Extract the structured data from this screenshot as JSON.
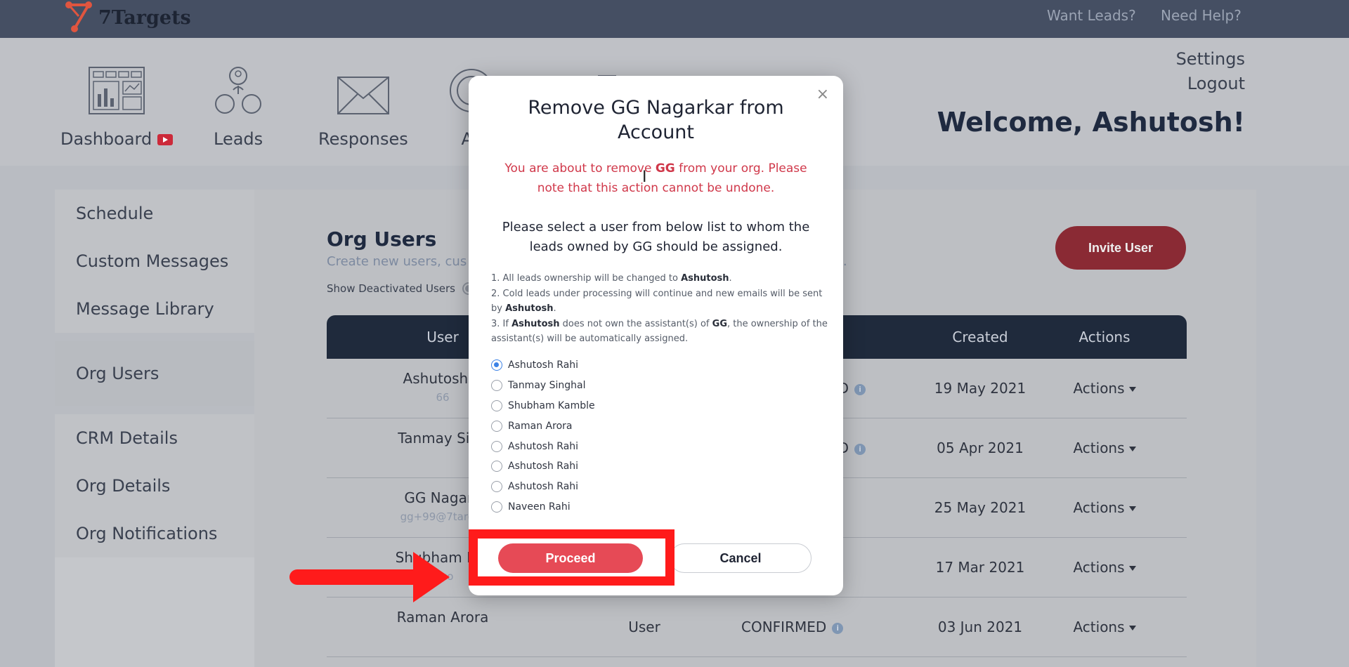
{
  "topbar": {
    "logo_text": "7Targets",
    "want_leads": "Want Leads?",
    "need_help": "Need Help?"
  },
  "nav": {
    "dashboard": "Dashboard",
    "leads": "Leads",
    "responses": "Responses",
    "assistants": "As"
  },
  "header": {
    "settings": "Settings",
    "logout": "Logout",
    "welcome": "Welcome, Ashutosh!"
  },
  "sidebar": {
    "items": [
      "Schedule",
      "Custom Messages",
      "Message Library",
      "Org Users",
      "CRM Details",
      "Org Details",
      "Org Notifications"
    ],
    "active": "Org Users"
  },
  "main": {
    "title": "Org Users",
    "subtitle": "Create new users, cus",
    "subtitle_end": "unt.",
    "show_deactivated": "Show Deactivated Users",
    "invite_button": "Invite User",
    "columns": {
      "user": "User",
      "created": "Created",
      "actions": "Actions"
    },
    "rows": [
      {
        "name": "Ashutosh R",
        "email": "66",
        "role": "",
        "status": "ORD",
        "created": "19 May 2021",
        "actions": "Actions"
      },
      {
        "name": "Tanmay Sing",
        "email": "",
        "role": "",
        "status": "ORD",
        "created": "05 Apr 2021",
        "actions": "Actions"
      },
      {
        "name": "GG Nagark",
        "email": "gg+99@7target",
        "role": "",
        "status": "",
        "created": "25 May 2021",
        "actions": "Actions"
      },
      {
        "name": "Shubham Kar",
        "email": "aico",
        "role": "",
        "status": "",
        "created": "17 Mar 2021",
        "actions": "Actions"
      },
      {
        "name": "Raman Arora",
        "email": "",
        "role": "User",
        "status": "CONFIRMED",
        "created": "03 Jun 2021",
        "actions": "Actions"
      }
    ]
  },
  "modal": {
    "title": "Remove GG Nagarkar from Account",
    "warning_pre": "You are about to remove ",
    "warning_bold": "GG",
    "warning_post": " from your org. Please note that this action cannot be undone.",
    "prompt": "Please select a user from below list to whom the leads owned by GG should be assigned.",
    "note1_pre": "1. All leads ownership will be changed to ",
    "note1_bold": "Ashutosh",
    "note1_post": ".",
    "note2_pre": "2. Cold leads under processing will continue and new emails will be sent by ",
    "note2_bold": "Ashutosh",
    "note2_post": ".",
    "note3_pre": "3. If ",
    "note3_bold": "Ashutosh",
    "note3_mid": " does not own the assistant(s) of ",
    "note3_bold2": "GG",
    "note3_post": ", the ownership of the assistant(s) will be automatically assigned.",
    "users": [
      "Ashutosh Rahi",
      "Tanmay Singhal",
      "Shubham Kamble",
      "Raman Arora",
      "Ashutosh Rahi",
      "Ashutosh Rahi",
      "Ashutosh Rahi",
      "Naveen Rahi"
    ],
    "selected_index": 0,
    "proceed": "Proceed",
    "cancel": "Cancel",
    "close": "×"
  },
  "colors": {
    "accent_red": "#e64a56",
    "annotation_red": "#ff1b1b",
    "warning_text": "#d0384a",
    "radio_blue": "#3b82e6",
    "table_header": "#1f2a3c"
  }
}
